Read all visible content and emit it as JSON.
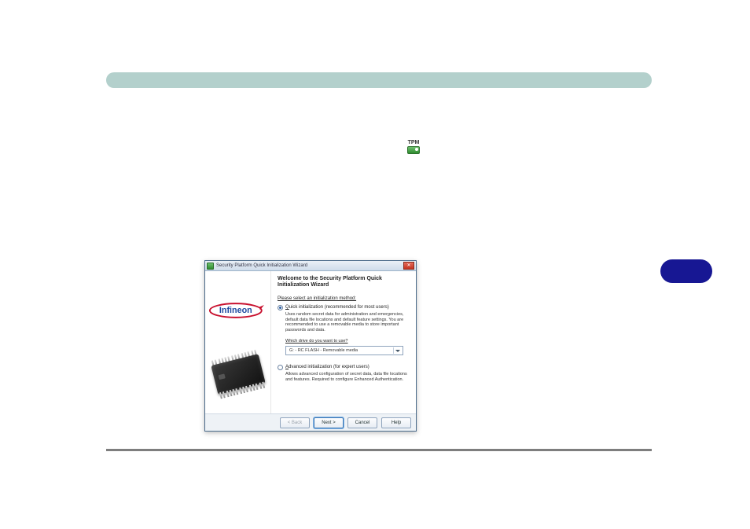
{
  "page": {
    "section_bar_color": "#b3d0cc",
    "pill_color": "#171793"
  },
  "tpm_badge": {
    "label": "TPM"
  },
  "wizard": {
    "window_title": "Security Platform Quick Initialization Wizard",
    "close_glyph": "✕",
    "heading": "Welcome to the Security Platform Quick Initialization Wizard",
    "select_method": "Please select an initialization method:",
    "quick": {
      "label_pre": "Q",
      "label_rest": "uick initialization (recommended for most users)",
      "desc": "Uses random secret data for administration and emergencies, default data file locations and default feature settings.\nYou are recommended to use a removable media to store important passwords and data."
    },
    "which_drive": "Which drive do you want to use?",
    "drive_selected": "G: - RC FLASH - Removable media",
    "advanced": {
      "label_pre": "A",
      "label_rest": "dvanced initialization (for expert users)",
      "desc": "Allows advanced configuration of secret data, data file locations and features. Required to configure Enhanced Authentication."
    },
    "buttons": {
      "back": "< Back",
      "next": "Next >",
      "cancel": "Cancel",
      "help": "Help"
    },
    "logo_text": "Infineon"
  }
}
